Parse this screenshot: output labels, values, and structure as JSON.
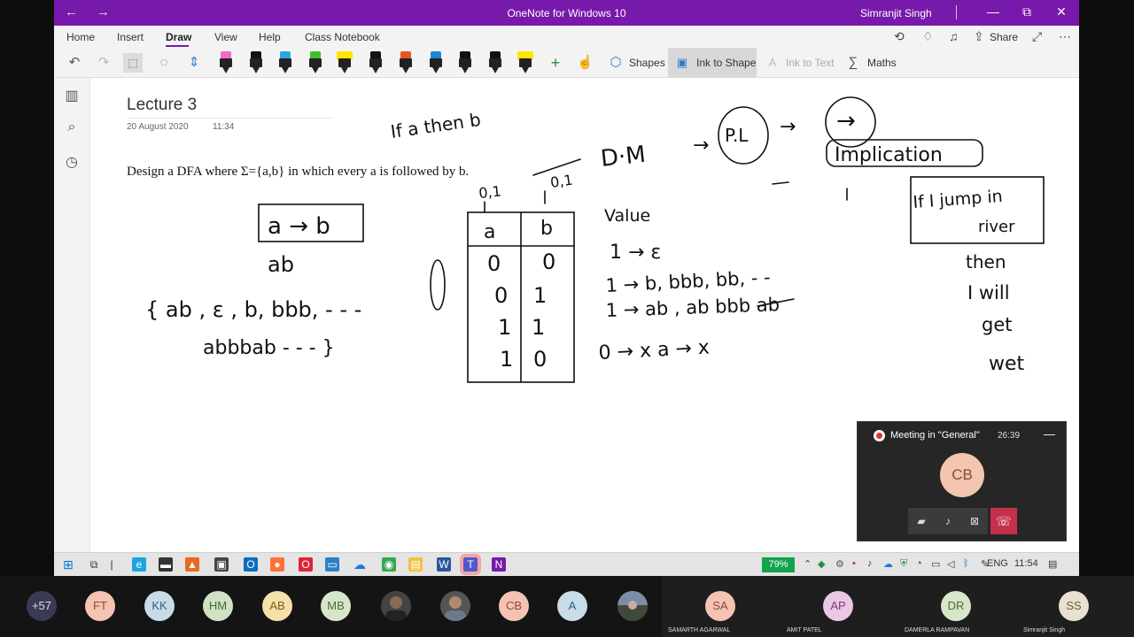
{
  "window": {
    "app_title": "OneNote for Windows 10",
    "user_name": "Simranjit Singh",
    "back_glyph": "←",
    "forward_glyph": "→",
    "minimize_glyph": "—",
    "restore_glyph": "⧉",
    "close_glyph": "✕"
  },
  "menu": {
    "tabs": [
      "Home",
      "Insert",
      "Draw",
      "View",
      "Help",
      "Class Notebook"
    ],
    "active_tab": "Draw",
    "share_label": "Share"
  },
  "toolbar": {
    "shapes_label": "Shapes",
    "ink_to_shape_label": "Ink to Shape",
    "ink_to_text_label": "Ink to Text",
    "maths_label": "Maths",
    "pen_colors": [
      "#f06bc7",
      "#111111",
      "#2aa7e0",
      "#3cbf2b",
      "#ffe500",
      "#111111",
      "#e8542a",
      "#1a86d6",
      "#111111",
      "#111111",
      "#ffe500"
    ]
  },
  "page": {
    "title": "Lecture 3",
    "date": "20 August 2020",
    "time": "11:34",
    "question_text": "Design a DFA where Σ={a,b} in which every a is followed by b.",
    "ink": {
      "if_a_then_b": "If a then b",
      "dm": "D·M",
      "pl": "P.L",
      "implication": "Implication",
      "arrow_symbol": "→",
      "a_to_b": "a → b",
      "ab": "ab",
      "set_line1": "{ ab , ε , b, bbb, - - -",
      "set_line2": "abbbab - - - }",
      "table_header": [
        "a",
        "b"
      ],
      "table_top_labels": [
        "0,1",
        "0,1"
      ],
      "table_rows": [
        [
          "0",
          "0"
        ],
        [
          "0",
          "1"
        ],
        [
          "1",
          "1"
        ],
        [
          "1",
          "0"
        ]
      ],
      "value_label": "Value",
      "value_lines": [
        "1  →  ε",
        "1  →  b, bbb, bb, - -",
        "1  →  ab , ab bbb ab",
        "0  → x   a → x"
      ],
      "box_text_1": "If I jump in",
      "box_text_2": "river",
      "then_lines": [
        "then",
        "I will",
        "get",
        "wet"
      ]
    }
  },
  "meeting": {
    "title": "Meeting in \"General\"",
    "timer": "26:39",
    "avatar_initials": "CB",
    "minimize_glyph": "—"
  },
  "taskbar": {
    "battery": "79%",
    "language": "ENG",
    "clock": "11:54"
  },
  "participants": {
    "overflow": "+57",
    "avatars": [
      {
        "initials": "FT",
        "bg": "#f4c3b3",
        "fg": "#8b4a35"
      },
      {
        "initials": "KK",
        "bg": "#c8dbe8",
        "fg": "#3a5d77"
      },
      {
        "initials": "HM",
        "bg": "#cfe3c4",
        "fg": "#466a35"
      },
      {
        "initials": "AB",
        "bg": "#f5e0a8",
        "fg": "#7a5d16"
      },
      {
        "initials": "MB",
        "bg": "#d7e6c8",
        "fg": "#4f6a3c"
      },
      {
        "initials": "CB",
        "bg": "#f4c3b3",
        "fg": "#8b4a35"
      },
      {
        "initials": "A",
        "bg": "#c8dbe8",
        "fg": "#3a5d77"
      }
    ],
    "named": [
      {
        "initials": "SA",
        "name": "SAMARTH AGARWAL",
        "bg": "#f4c3b3",
        "fg": "#8b4a35"
      },
      {
        "initials": "AP",
        "name": "AMIT PATEL",
        "bg": "#e9c8e6",
        "fg": "#7a3b74"
      },
      {
        "initials": "DR",
        "name": "DAMERLA RAMPAVAN",
        "bg": "#d7e6c8",
        "fg": "#4f6a3c"
      },
      {
        "initials": "SS",
        "name": "Simranjit Singh",
        "bg": "#e8e0d0",
        "fg": "#6d5c3c"
      }
    ]
  }
}
